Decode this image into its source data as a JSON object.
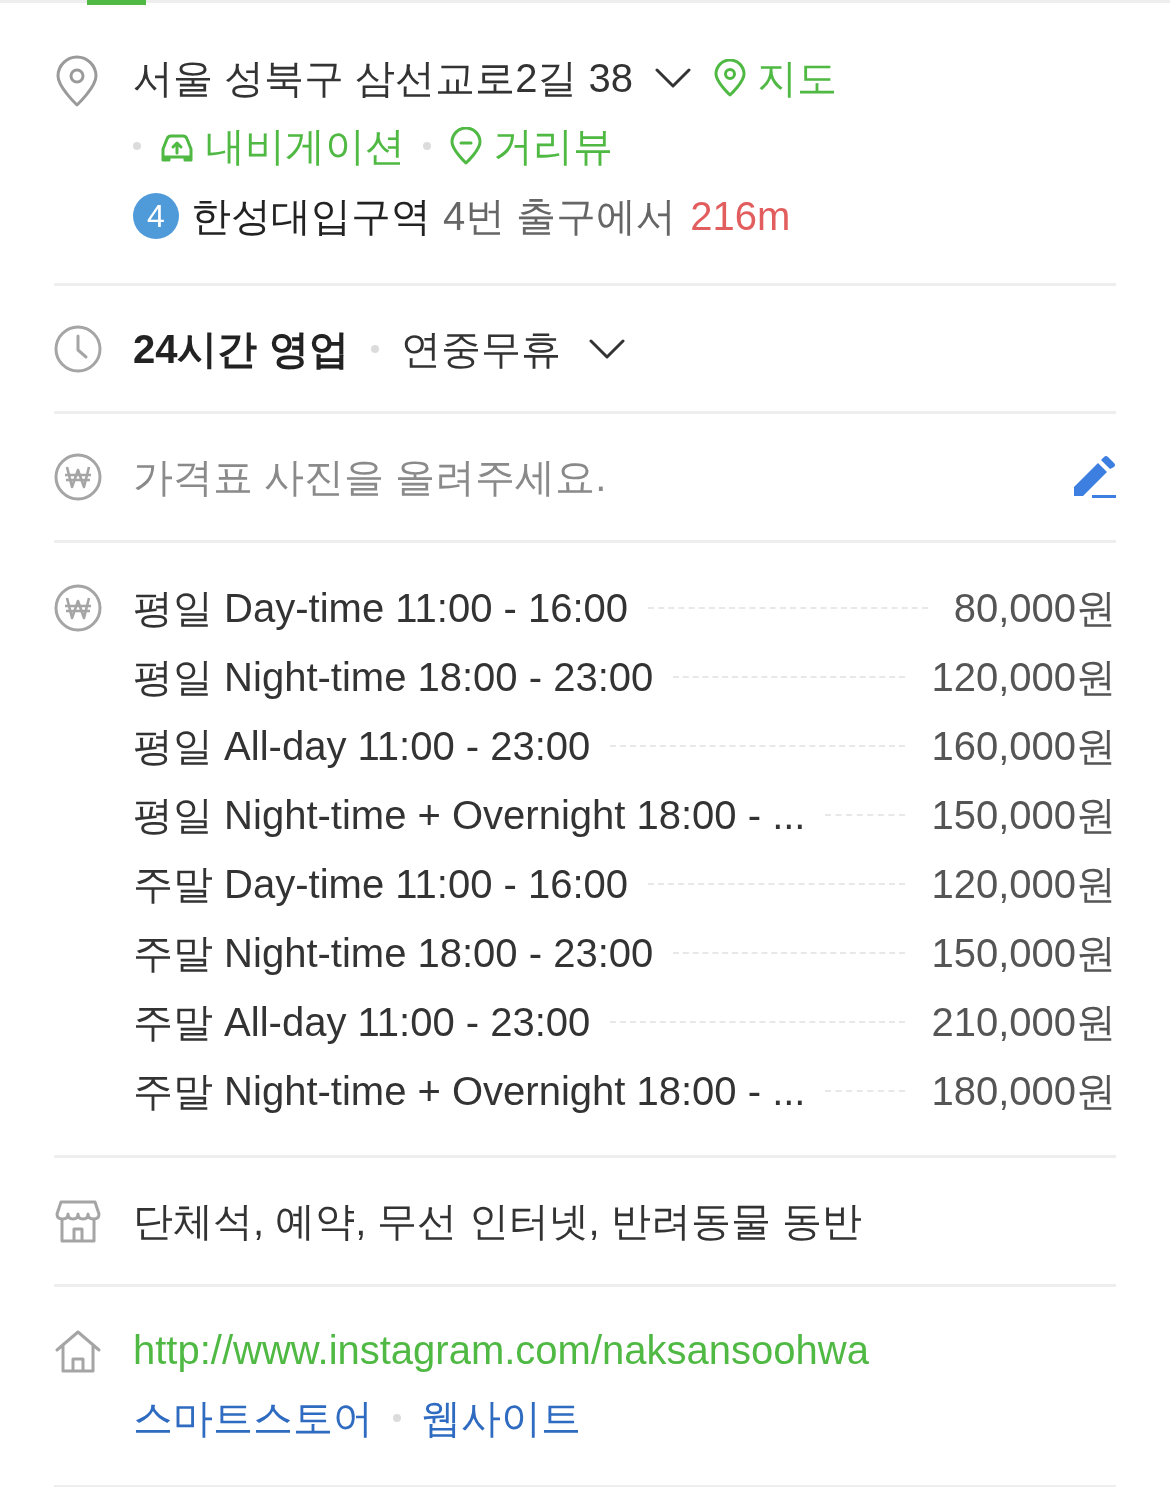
{
  "address": {
    "text": "서울 성북구 삼선교로2길 38",
    "expanded": false,
    "links": [
      {
        "kind": "map",
        "label": "지도"
      },
      {
        "kind": "navigation",
        "label": "내비게이션"
      },
      {
        "kind": "street_view",
        "label": "거리뷰"
      }
    ],
    "subway": {
      "line": "4",
      "station": "한성대입구역",
      "exit": "4번 출구에서",
      "distance": "216m"
    }
  },
  "hours": {
    "status": "24시간 영업",
    "note": "연중무휴",
    "expanded": false
  },
  "price_photo": {
    "prompt": "가격표 사진을 올려주세요."
  },
  "prices": [
    {
      "name": "평일 Day-time 11:00 - 16:00",
      "price": "80,000원"
    },
    {
      "name": "평일 Night-time 18:00 - 23:00",
      "price": "120,000원"
    },
    {
      "name": "평일 All-day 11:00 - 23:00",
      "price": "160,000원"
    },
    {
      "name": "평일 Night-time + Overnight 18:00 - ...",
      "price": "150,000원"
    },
    {
      "name": "주말 Day-time 11:00 - 16:00",
      "price": "120,000원"
    },
    {
      "name": "주말 Night-time 18:00 - 23:00",
      "price": "150,000원"
    },
    {
      "name": "주말 All-day 11:00 - 23:00",
      "price": "210,000원"
    },
    {
      "name": "주말 Night-time + Overnight 18:00 - ...",
      "price": "180,000원"
    }
  ],
  "amenities": "단체석, 예약, 무선 인터넷, 반려동물 동반",
  "website": {
    "url": "http://www.instagram.com/naksansoohwa",
    "links": [
      "스마트스토어",
      "웹사이트"
    ]
  }
}
